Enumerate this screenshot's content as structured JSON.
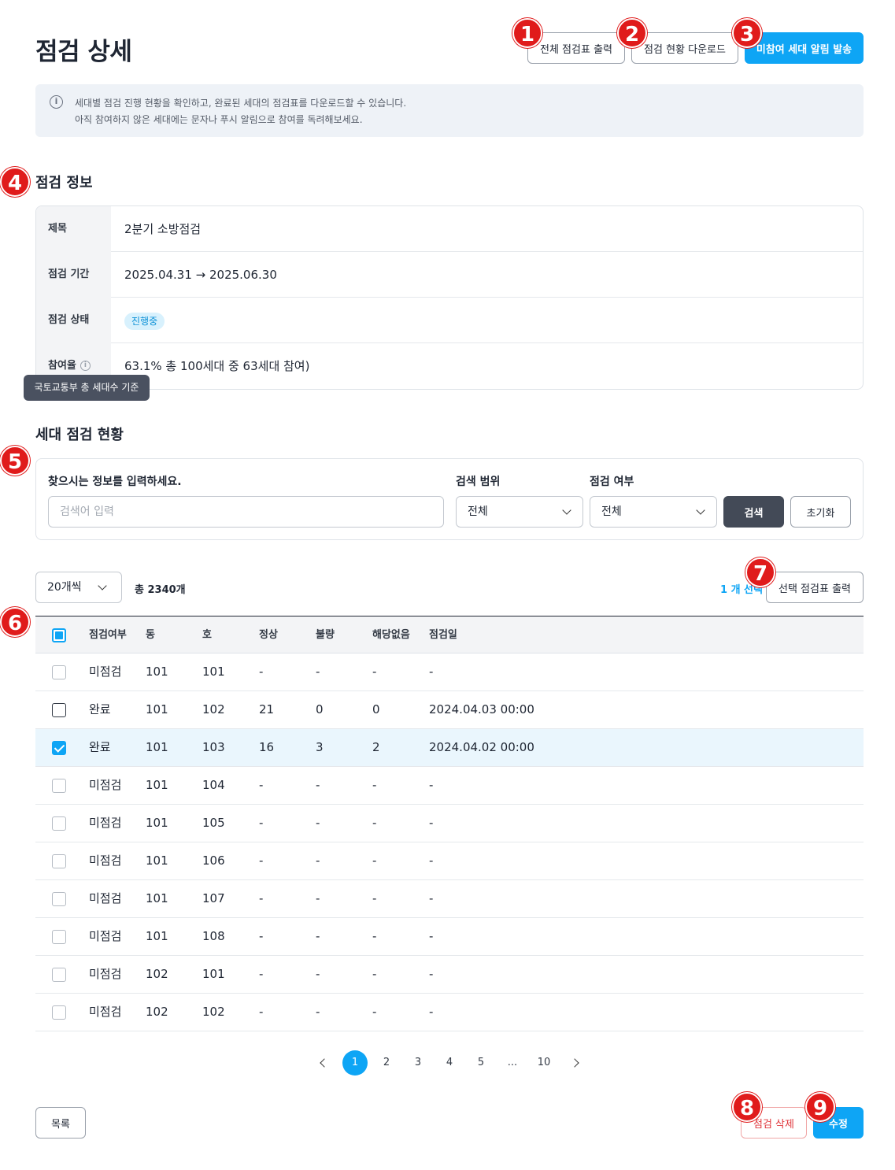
{
  "page": {
    "title": "점검 상세",
    "annotations": [
      "1",
      "2",
      "3",
      "4",
      "5",
      "6",
      "7",
      "8",
      "9"
    ]
  },
  "header_actions": {
    "print_all_label": "전체 점검표 출력",
    "download_label": "점검 현황 다운로드",
    "notify_label": "미참여 세대 알림 발송"
  },
  "notice": {
    "line1": "세대별 점검 진행 현황을 확인하고, 완료된 세대의 점검표를 다운로드할 수 있습니다.",
    "line2": "아직 참여하지 않은 세대에는 문자나 푸시 알림으로 참여를 독려해보세요."
  },
  "info_section": {
    "title": "점검 정보",
    "rows": [
      {
        "label": "제목",
        "value": "2분기 소방점검"
      },
      {
        "label": "점검 기간",
        "value": "2025.04.31 → 2025.06.30"
      },
      {
        "label": "점검 상태",
        "value": "진행중"
      },
      {
        "label": "참여율",
        "value": "63.1% 총 100세대 중 63세대 참여)"
      }
    ],
    "tooltip": "국토교통부 총 세대수 기준"
  },
  "status_section": {
    "title": "세대 점검 현황",
    "search": {
      "keyword_label": "찾으시는 정보를 입력하세요.",
      "keyword_placeholder": "검색어 입력",
      "scope_label": "검색 범위",
      "scope_value": "전체",
      "status_label": "점검 여부",
      "status_value": "전체",
      "search_button": "검색",
      "reset_button": "초기화"
    },
    "page_size": "20개씩",
    "total": "총 2340개",
    "selected_count": "1 개 선택",
    "print_selected_label": "선택 점검표 출력"
  },
  "table": {
    "headers": [
      "점검여부",
      "동",
      "호",
      "정상",
      "불량",
      "해당없음",
      "점검일"
    ],
    "rows": [
      {
        "status": "미점검",
        "dong": "101",
        "ho": "101",
        "normal": "-",
        "bad": "-",
        "na": "-",
        "date": "-",
        "checked": false
      },
      {
        "status": "완료",
        "dong": "101",
        "ho": "102",
        "normal": "21",
        "bad": "0",
        "na": "0",
        "date": "2024.04.03 00:00",
        "checked": false
      },
      {
        "status": "완료",
        "dong": "101",
        "ho": "103",
        "normal": "16",
        "bad": "3",
        "na": "2",
        "date": "2024.04.02 00:00",
        "checked": true
      },
      {
        "status": "미점검",
        "dong": "101",
        "ho": "104",
        "normal": "-",
        "bad": "-",
        "na": "-",
        "date": "-",
        "checked": false
      },
      {
        "status": "미점검",
        "dong": "101",
        "ho": "105",
        "normal": "-",
        "bad": "-",
        "na": "-",
        "date": "-",
        "checked": false
      },
      {
        "status": "미점검",
        "dong": "101",
        "ho": "106",
        "normal": "-",
        "bad": "-",
        "na": "-",
        "date": "-",
        "checked": false
      },
      {
        "status": "미점검",
        "dong": "101",
        "ho": "107",
        "normal": "-",
        "bad": "-",
        "na": "-",
        "date": "-",
        "checked": false
      },
      {
        "status": "미점검",
        "dong": "101",
        "ho": "108",
        "normal": "-",
        "bad": "-",
        "na": "-",
        "date": "-",
        "checked": false
      },
      {
        "status": "미점검",
        "dong": "102",
        "ho": "101",
        "normal": "-",
        "bad": "-",
        "na": "-",
        "date": "-",
        "checked": false
      },
      {
        "status": "미점검",
        "dong": "102",
        "ho": "102",
        "normal": "-",
        "bad": "-",
        "na": "-",
        "date": "-",
        "checked": false
      }
    ]
  },
  "pagination": {
    "pages": [
      "1",
      "2",
      "3",
      "4",
      "5",
      "...",
      "10"
    ],
    "current": "1"
  },
  "footer": {
    "list_label": "목록",
    "delete_label": "점검 삭제",
    "edit_label": "수정"
  },
  "colors": {
    "primary": "#0ea5f5",
    "annotation": "#e01b1b",
    "danger": "#e0363b",
    "dark_button": "#434a57"
  }
}
